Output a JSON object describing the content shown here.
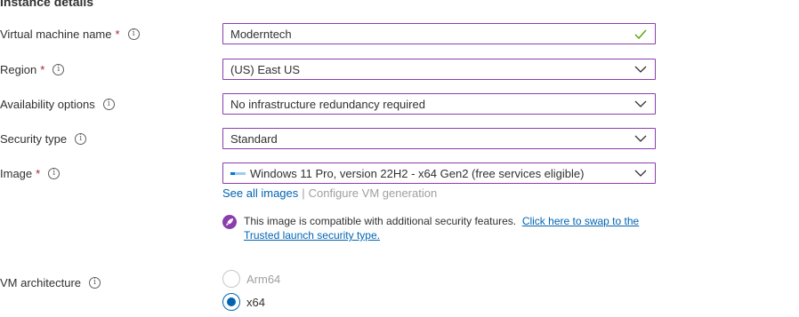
{
  "section": {
    "title": "Instance details"
  },
  "fields": {
    "vm_name": {
      "label": "Virtual machine name",
      "required": "*",
      "value": "Moderntech"
    },
    "region": {
      "label": "Region",
      "required": "*",
      "value": "(US) East US"
    },
    "availability": {
      "label": "Availability options",
      "value": "No infrastructure redundancy required"
    },
    "security": {
      "label": "Security type",
      "value": "Standard"
    },
    "image": {
      "label": "Image",
      "required": "*",
      "value": "Windows 11 Pro, version 22H2 - x64 Gen2 (free services eligible)"
    },
    "architecture": {
      "label": "VM architecture"
    }
  },
  "image_links": {
    "see_all": "See all images",
    "separator": "|",
    "configure": "Configure VM generation"
  },
  "info": {
    "text": "This image is compatible with additional security features.",
    "link": "Click here to swap to the Trusted launch security type."
  },
  "architecture_options": [
    {
      "label": "Arm64",
      "selected": false,
      "disabled": true
    },
    {
      "label": "x64",
      "selected": true,
      "disabled": false
    }
  ],
  "icons": {
    "info": "info-icon",
    "check": "check-icon",
    "chevron": "chevron-down-icon",
    "rocket": "rocket-icon",
    "os": "windows-os-icon"
  },
  "colors": {
    "accent_border": "#8a3eac",
    "link": "#0064b4",
    "required": "#a4262c",
    "success": "#57a300",
    "disabled": "#a19f9d"
  }
}
